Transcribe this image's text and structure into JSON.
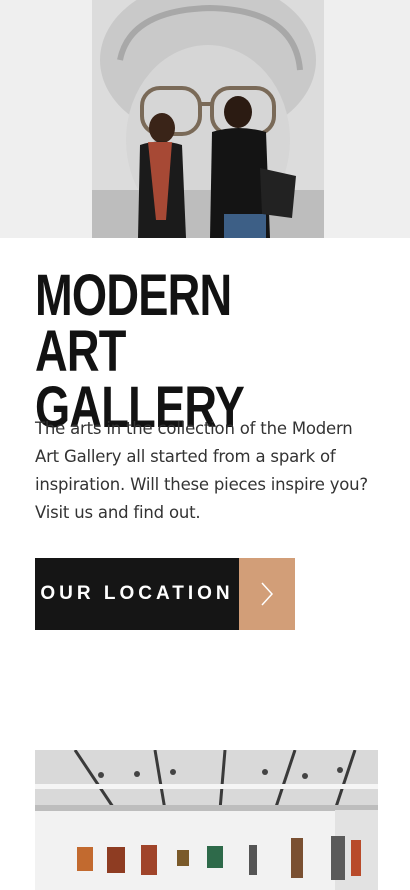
{
  "hero": {
    "image": "two visitors viewing a large pencil portrait"
  },
  "heading": {
    "line1": "MODERN",
    "line2": "ART GALLERY"
  },
  "description": "The arts in the collection of the Modern Art Gallery all started from a spark of inspiration. Will these pieces inspire you? Visit us and find out.",
  "cta": {
    "label": "OUR LOCATION",
    "icon": "chevron-right-icon",
    "accent": "#d29e78",
    "dark": "#151515"
  },
  "gallery_image": "interior of exhibition hall with framed artworks"
}
